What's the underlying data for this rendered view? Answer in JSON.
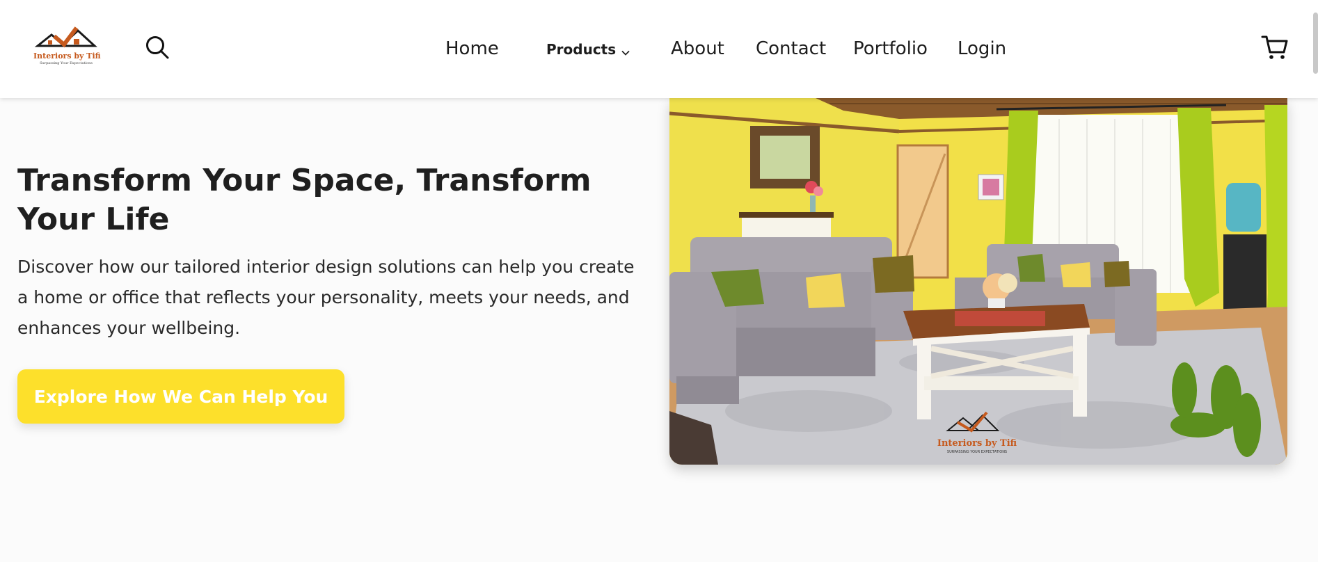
{
  "header": {
    "logo": {
      "name": "Interiors by Tifi",
      "tagline": "Surpassing Your Expectations",
      "icon": "house-logo-icon"
    },
    "search_icon": "search-icon",
    "cart_icon": "cart-icon",
    "nav": {
      "home": "Home",
      "products": "Products",
      "about": "About",
      "contact": "Contact",
      "portfolio": "Portfolio",
      "login": "Login"
    }
  },
  "hero": {
    "title": "Transform Your Space, Transform Your Life",
    "description": "Discover how our tailored interior design solutions can help you create a home or office that reflects your personality, meets your needs, and enhances your wellbeing.",
    "cta_label": "Explore How We Can Help You",
    "image": {
      "watermark_name": "Interiors by Tifi",
      "watermark_tagline": "SURPASSING YOUR EXPECTATIONS"
    }
  },
  "colors": {
    "accent": "#fde02b",
    "brand_orange": "#c65a1e",
    "background": "#fbfbfb"
  }
}
